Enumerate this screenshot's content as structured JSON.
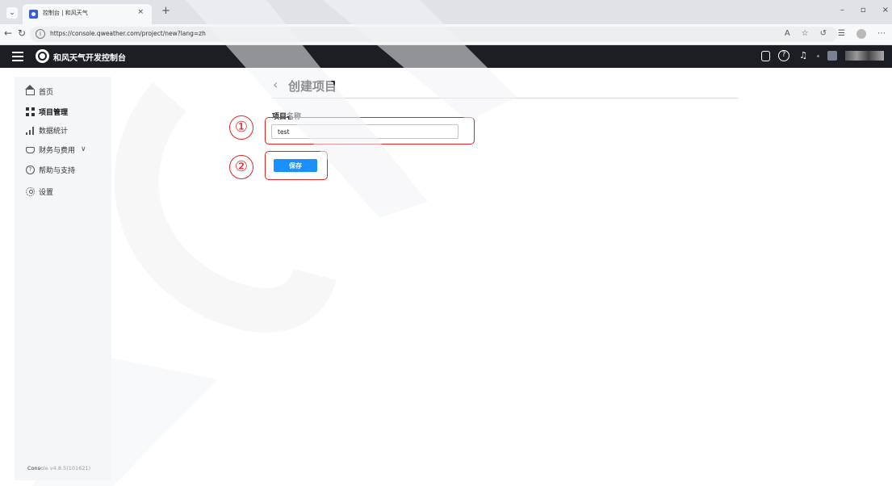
{
  "browser": {
    "tab_title": "控制台 | 和风天气",
    "tab_close": "×",
    "new_tab": "+",
    "url": "https://console.qweather.com/project/new?lang=zh",
    "window_controls": [
      "–",
      "▫",
      "×"
    ]
  },
  "appbar": {
    "app_name": "和风天气开发控制台"
  },
  "sidebar": {
    "items": [
      {
        "label": "首页",
        "icon": "home-icon"
      },
      {
        "label": "项目管理",
        "icon": "grid-icon",
        "active": true
      },
      {
        "label": "数据统计",
        "icon": "bar-chart-icon"
      },
      {
        "label": "财务与费用",
        "icon": "gift-icon",
        "expandable": true
      },
      {
        "label": "帮助与支持",
        "icon": "help-icon"
      },
      {
        "label": "设置",
        "icon": "gear-icon"
      }
    ],
    "version": "Console v4.8.5(101621)"
  },
  "main": {
    "page_title": "创建项目",
    "field_label": "项目名称",
    "project_name_value": "test",
    "save_label": "保存"
  },
  "annotations": [
    "①",
    "②"
  ],
  "colors": {
    "accent": "#1a8fff",
    "header_bg": "#1b1e22",
    "annotation_red": "#e02424"
  }
}
